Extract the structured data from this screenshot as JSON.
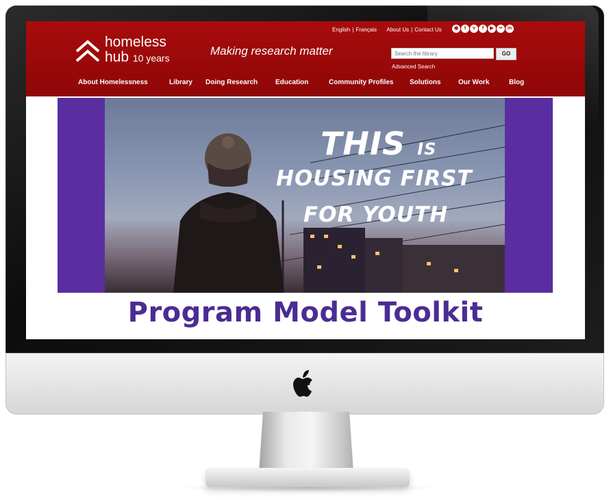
{
  "site": {
    "logo_name": "homeless",
    "logo_name2": "hub",
    "logo_anniversary": "10 years",
    "tagline": "Making research matter"
  },
  "top_links": {
    "english": "English",
    "francais": "Français",
    "about": "About Us",
    "contact": "Contact Us"
  },
  "social_icons": [
    "rss-icon",
    "twitter-icon",
    "vimeo-icon",
    "facebook-icon",
    "youtube-icon",
    "flickr-icon",
    "linkedin-icon"
  ],
  "search": {
    "placeholder": "Search the library",
    "button": "GO",
    "advanced": "Advanced Search"
  },
  "nav": {
    "items": [
      "About Homelessness",
      "Library",
      "Doing Research",
      "Education",
      "Community Profiles",
      "Solutions",
      "Our Work",
      "Blog"
    ]
  },
  "banner": {
    "line1_big": "THIS",
    "line1_small": "IS",
    "line2": "HOUSING FIRST",
    "line3": "FOR YOUTH"
  },
  "page": {
    "title": "Program Model Toolkit"
  },
  "colors": {
    "header_red": "#a80c0c",
    "banner_purple": "#5a2ea0",
    "title_purple": "#4b2c93"
  }
}
